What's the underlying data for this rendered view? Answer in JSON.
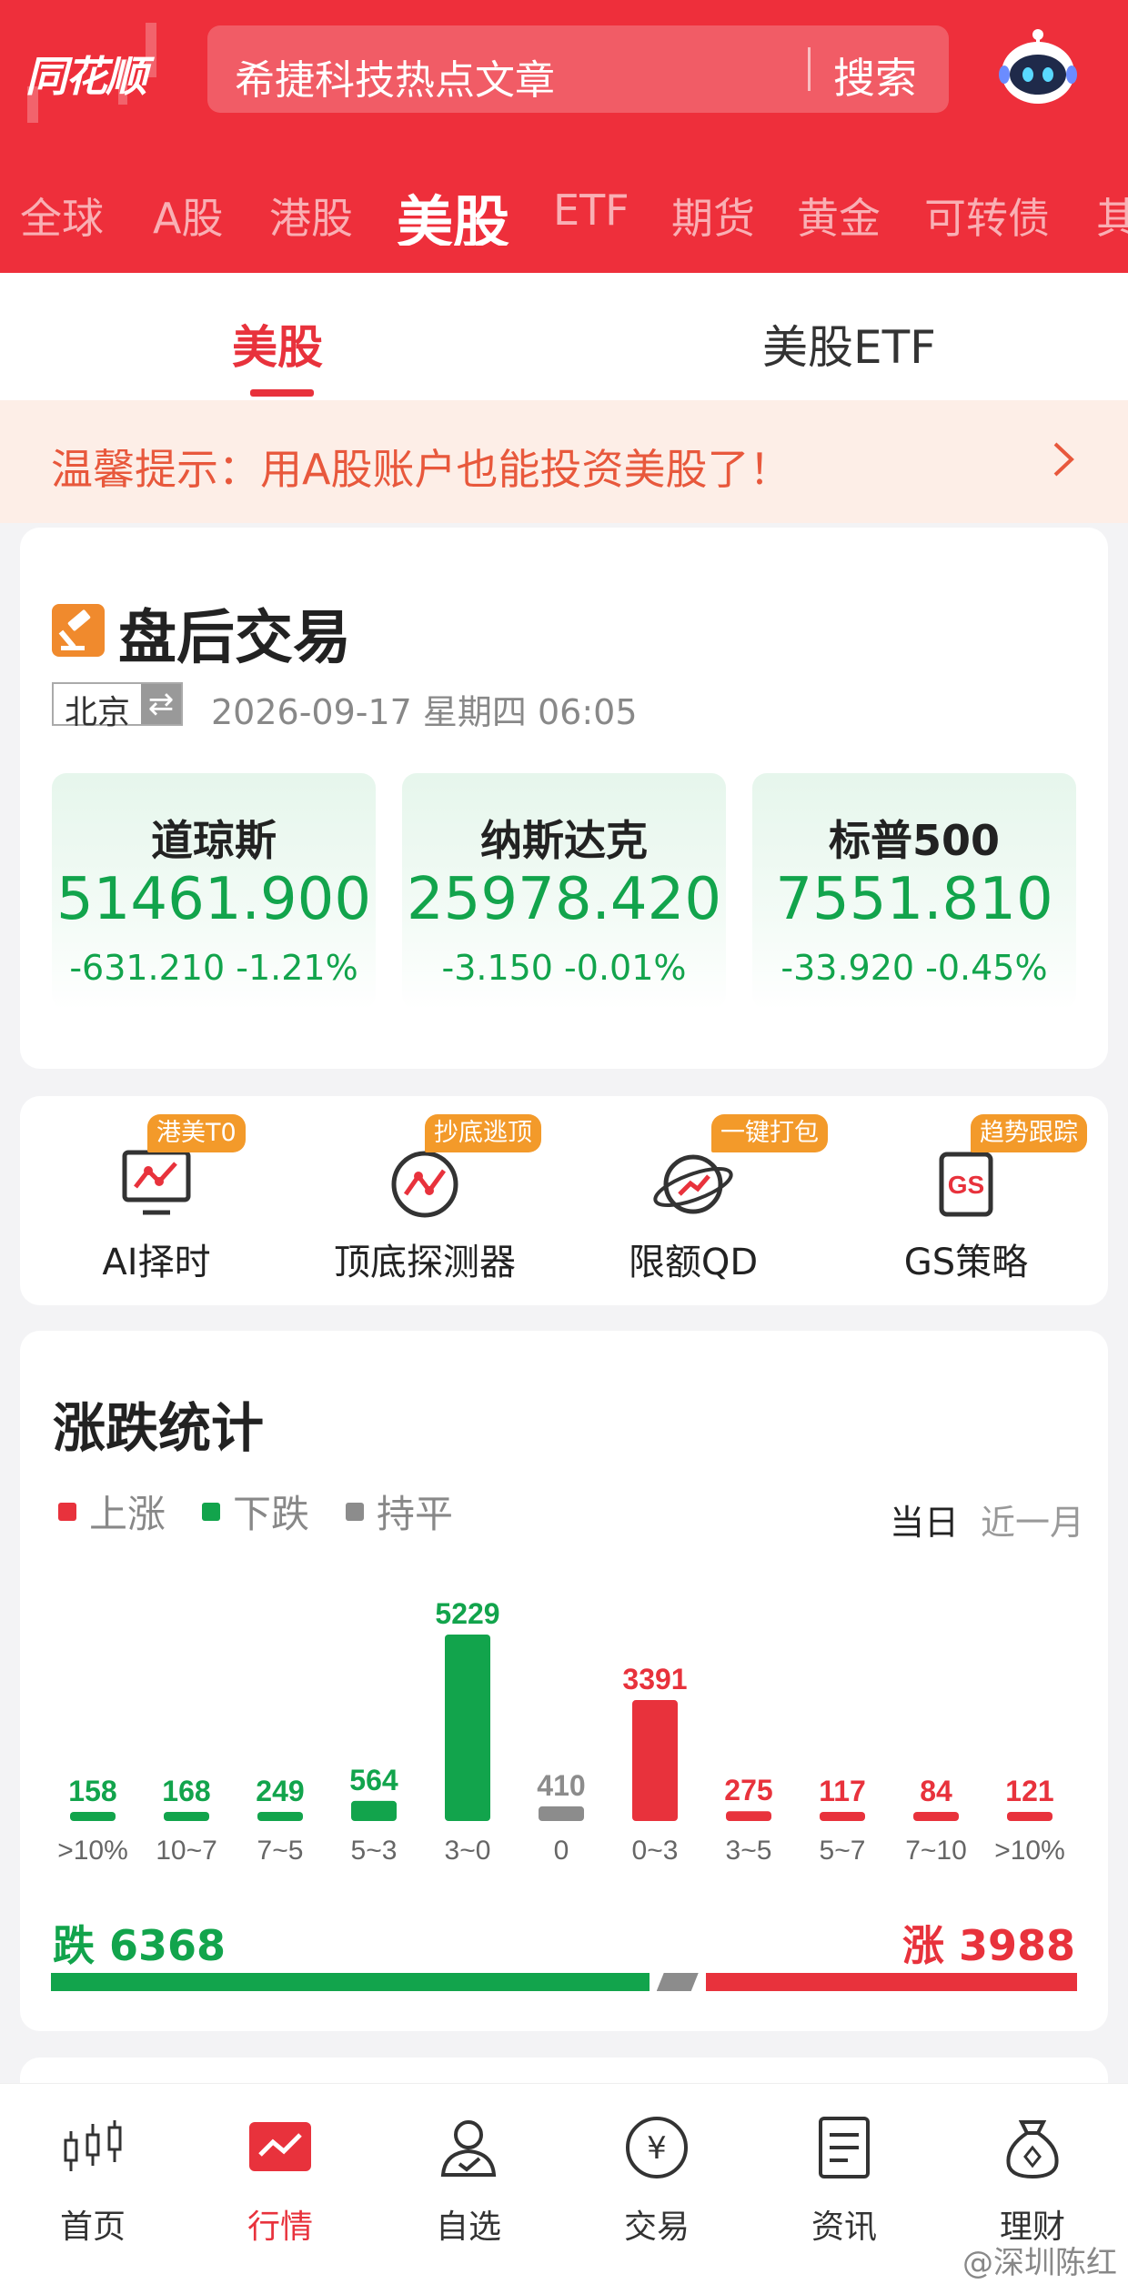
{
  "header": {
    "logo": "同花顺",
    "search_placeholder": "希捷科技热点文章",
    "search_button": "搜索",
    "market_tabs": [
      "全球",
      "A股",
      "港股",
      "美股",
      "ETF",
      "期货",
      "黄金",
      "可转债",
      "其"
    ]
  },
  "subtabs": [
    "美股",
    "美股ETF"
  ],
  "notice": "温馨提示：用A股账户也能投资美股了！",
  "after_hours": {
    "title": "盘后交易",
    "timezone": "北京",
    "timezone_switch": "⇄",
    "datetime": "2026-09-17 星期四  06:05",
    "indices": [
      {
        "name": "道琼斯",
        "price": "51461.900",
        "change": "-631.210  -1.21%"
      },
      {
        "name": "纳斯达克",
        "price": "25978.420",
        "change": "-3.150  -0.01%"
      },
      {
        "name": "标普500",
        "price": "7551.810",
        "change": "-33.920  -0.45%"
      }
    ]
  },
  "tools": [
    {
      "label": "AI择时",
      "badge": "港美T0"
    },
    {
      "label": "顶底探测器",
      "badge": "抄底逃顶"
    },
    {
      "label": "限额QD",
      "badge": "一键打包"
    },
    {
      "label": "GS策略",
      "badge": "趋势跟踪"
    }
  ],
  "stats": {
    "title": "涨跌统计",
    "legend": [
      "上涨",
      "下跌",
      "持平"
    ],
    "period_on": "当日",
    "period_off": "近一月",
    "fall_total": "跌 6368",
    "rise_total": "涨 3988",
    "colors": {
      "rise": "#e8323c",
      "fall": "#12a44c",
      "flat": "#8c8c8c"
    }
  },
  "chart_data": {
    "type": "bar",
    "categories": [
      ">10%",
      "10~7",
      "7~5",
      "5~3",
      "3~0",
      "0",
      "0~3",
      "3~5",
      "5~7",
      "7~10",
      ">10%"
    ],
    "values": [
      158,
      168,
      249,
      564,
      5229,
      410,
      3391,
      275,
      117,
      84,
      121
    ],
    "kinds": [
      "fall",
      "fall",
      "fall",
      "fall",
      "fall",
      "flat",
      "rise",
      "rise",
      "rise",
      "rise",
      "rise"
    ],
    "summary": {
      "fall": 6368,
      "rise": 3988,
      "flat": 410
    }
  },
  "bottom_nav": [
    "首页",
    "行情",
    "自选",
    "交易",
    "资讯",
    "理财"
  ],
  "watermark": "@深圳陈红"
}
